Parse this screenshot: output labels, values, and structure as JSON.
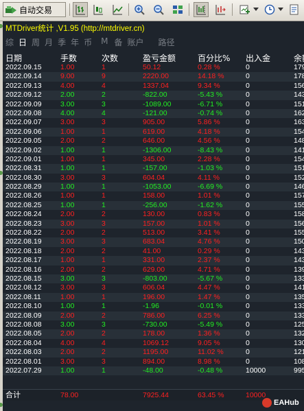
{
  "toolbar": {
    "auto_trade_label": "自动交易"
  },
  "indicator": {
    "title": "MTDriver统计 ,V1.95 (http://mtdriver.cn)",
    "tabs": [
      "综",
      "日",
      "周",
      "月",
      "季",
      "年",
      "币",
      "M",
      "备",
      "账户",
      "路径"
    ],
    "active_tab": "日",
    "columns": [
      "日期",
      "手数",
      "次数",
      "盈亏金额",
      "百分比%",
      "出入金",
      "余额"
    ],
    "rows": [
      [
        "2022.09.15",
        "1.00",
        "1",
        "50.12",
        "0.28 %",
        "0",
        "179"
      ],
      [
        "2022.09.14",
        "9.00",
        "9",
        "2220.00",
        "14.18 %",
        "0",
        "178"
      ],
      [
        "2022.09.13",
        "4.00",
        "4",
        "1337.04",
        "9.34 %",
        "0",
        "156"
      ],
      [
        "2022.09.12",
        "2.00",
        "2",
        "-822.00",
        "-5.43 %",
        "0",
        "143"
      ],
      [
        "2022.09.09",
        "3.00",
        "3",
        "-1089.00",
        "-6.71 %",
        "0",
        "151"
      ],
      [
        "2022.09.08",
        "4.00",
        "4",
        "-121.00",
        "-0.74 %",
        "0",
        "162"
      ],
      [
        "2022.09.07",
        "3.00",
        "3",
        "905.00",
        "5.86 %",
        "0",
        "163"
      ],
      [
        "2022.09.06",
        "1.00",
        "1",
        "619.00",
        "4.18 %",
        "0",
        "154"
      ],
      [
        "2022.09.05",
        "2.00",
        "2",
        "646.00",
        "4.56 %",
        "0",
        "148"
      ],
      [
        "2022.09.02",
        "1.00",
        "1",
        "-1306.00",
        "-8.43 %",
        "0",
        "141"
      ],
      [
        "2022.09.01",
        "1.00",
        "1",
        "345.00",
        "2.28 %",
        "0",
        "154"
      ],
      [
        "2022.08.31",
        "1.00",
        "1",
        "-157.00",
        "-1.03 %",
        "0",
        "151"
      ],
      [
        "2022.08.30",
        "3.00",
        "3",
        "604.04",
        "4.11 %",
        "0",
        "152"
      ],
      [
        "2022.08.29",
        "1.00",
        "1",
        "-1053.00",
        "-6.69 %",
        "0",
        "146"
      ],
      [
        "2022.08.26",
        "1.00",
        "1",
        "158.00",
        "1.01 %",
        "0",
        "157"
      ],
      [
        "2022.08.25",
        "1.00",
        "1",
        "-256.00",
        "-1.62 %",
        "0",
        "155"
      ],
      [
        "2022.08.24",
        "2.00",
        "2",
        "130.00",
        "0.83 %",
        "0",
        "158"
      ],
      [
        "2022.08.23",
        "3.00",
        "3",
        "157.00",
        "1.01 %",
        "0",
        "156"
      ],
      [
        "2022.08.22",
        "2.00",
        "2",
        "513.00",
        "3.41 %",
        "0",
        "155"
      ],
      [
        "2022.08.19",
        "3.00",
        "3",
        "683.04",
        "4.76 %",
        "0",
        "150"
      ],
      [
        "2022.08.18",
        "2.00",
        "2",
        "41.00",
        "0.29 %",
        "0",
        "143"
      ],
      [
        "2022.08.17",
        "1.00",
        "1",
        "331.00",
        "2.37 %",
        "0",
        "143"
      ],
      [
        "2022.08.16",
        "2.00",
        "2",
        "629.00",
        "4.71 %",
        "0",
        "139"
      ],
      [
        "2022.08.15",
        "3.00",
        "3",
        "-803.00",
        "-5.67 %",
        "0",
        "133"
      ],
      [
        "2022.08.12",
        "3.00",
        "3",
        "606.04",
        "4.47 %",
        "0",
        "141"
      ],
      [
        "2022.08.11",
        "1.00",
        "1",
        "196.00",
        "1.47 %",
        "0",
        "135"
      ],
      [
        "2022.08.10",
        "1.00",
        "1",
        "-1.96",
        "-0.01 %",
        "0",
        "133"
      ],
      [
        "2022.08.09",
        "2.00",
        "2",
        "786.00",
        "6.25 %",
        "0",
        "133"
      ],
      [
        "2022.08.08",
        "3.00",
        "3",
        "-730.00",
        "-5.49 %",
        "0",
        "125"
      ],
      [
        "2022.08.05",
        "2.00",
        "2",
        "178.00",
        "1.36 %",
        "0",
        "132"
      ],
      [
        "2022.08.04",
        "4.00",
        "4",
        "1069.12",
        "9.05 %",
        "0",
        "130"
      ],
      [
        "2022.08.03",
        "2.00",
        "2",
        "1195.00",
        "11.02 %",
        "0",
        "121"
      ],
      [
        "2022.08.01",
        "3.00",
        "3",
        "894.00",
        "8.98 %",
        "0",
        "108"
      ],
      [
        "2022.07.29",
        "1.00",
        "1",
        "-48.00",
        "-0.48 %",
        "10000",
        "995"
      ]
    ],
    "total": {
      "label": "合计",
      "lots": "78.00",
      "profit": "7925.44",
      "percent": "63.45 %",
      "deposit": "10000"
    }
  },
  "watermark": {
    "text": "EAHub"
  },
  "colors": {
    "profit": "#ff2020",
    "loss": "#22ee22",
    "title": "#ffff00",
    "panel": "#1e242c"
  }
}
